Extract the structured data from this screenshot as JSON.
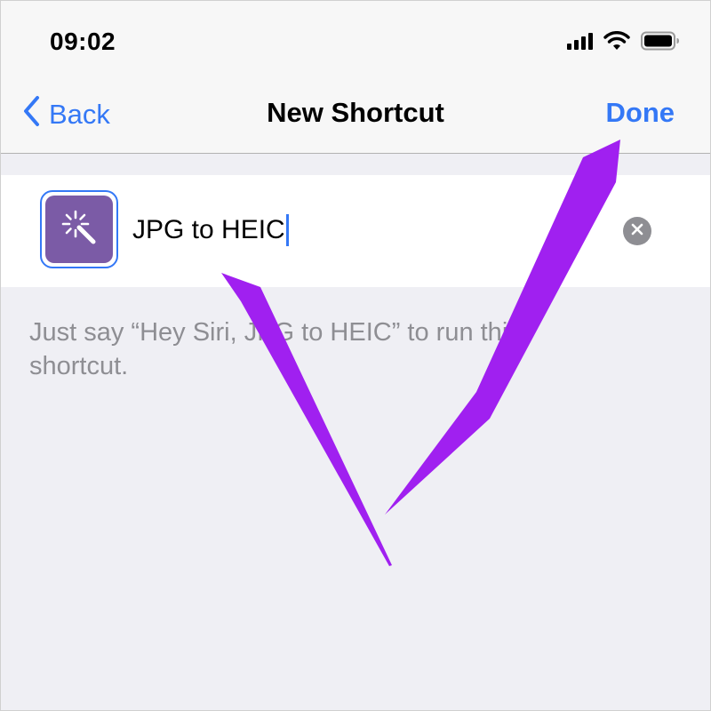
{
  "status_bar": {
    "time": "09:02",
    "icons": [
      "cellular-signal-icon",
      "wifi-icon",
      "battery-icon"
    ]
  },
  "nav": {
    "back_label": "Back",
    "title": "New Shortcut",
    "done_label": "Done"
  },
  "shortcut": {
    "name": "JPG to HEIC",
    "icon": "magic-wand-icon",
    "icon_color": "#7b5ba6"
  },
  "hint": "Just say “Hey Siri, JPG to HEIC” to run this shortcut.",
  "colors": {
    "accent": "#3478f6",
    "annotation_arrow": "#a020f0",
    "secondary_text": "#8e8e93"
  }
}
